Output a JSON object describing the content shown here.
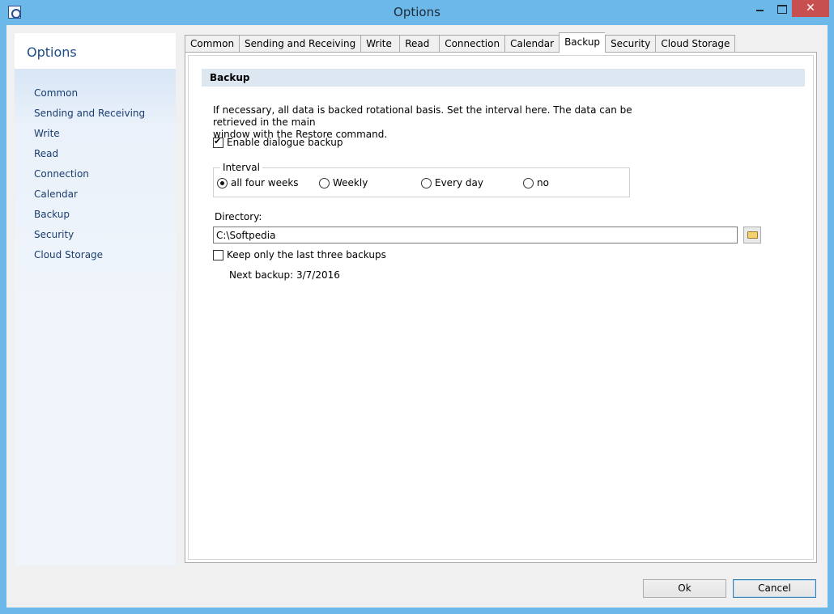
{
  "window": {
    "title": "Options"
  },
  "nav": {
    "title": "Options",
    "items": [
      "Common",
      "Sending and Receiving",
      "Write",
      "Read",
      "Connection",
      "Calendar",
      "Backup",
      "Security",
      "Cloud Storage"
    ]
  },
  "tabs": [
    "Common",
    "Sending and Receiving",
    "Write",
    "Read",
    "Connection",
    "Calendar",
    "Backup",
    "Security",
    "Cloud Storage"
  ],
  "active_tab": "Backup",
  "backup": {
    "header": "Backup",
    "description_line1": "If necessary, all data is backed rotational basis. Set the interval here. The data can be retrieved in the main",
    "description_line2": "window with the Restore command.",
    "enable_label": "Enable dialogue backup",
    "enable_checked": true,
    "interval_label": "Interval",
    "interval_options": [
      "all four weeks",
      "Weekly",
      "Every day",
      "no"
    ],
    "interval_selected": "all four weeks",
    "directory_label": "Directory:",
    "directory_value": "C:\\Softpedia",
    "keep_label": "Keep only the last three backups",
    "keep_checked": false,
    "next_backup": "Next backup: 3/7/2016"
  },
  "buttons": {
    "ok": "Ok",
    "cancel": "Cancel"
  }
}
